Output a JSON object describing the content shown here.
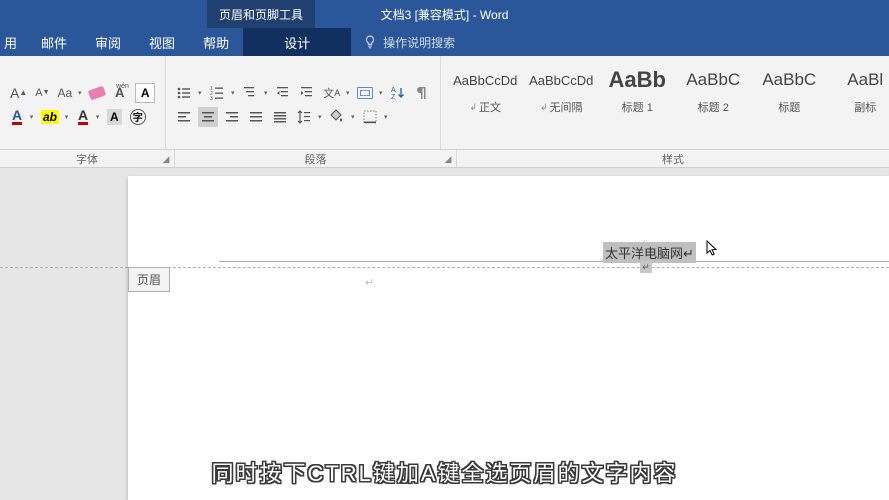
{
  "title": {
    "context_tab": "页眉和页脚工具",
    "document": "文档3 [兼容模式]  -  Word"
  },
  "menu": {
    "items": [
      "用",
      "邮件",
      "审阅",
      "视图",
      "帮助",
      "设计"
    ],
    "active_index": 5,
    "tell_me": "操作说明搜索"
  },
  "font_group": {
    "label": "字体"
  },
  "para_group": {
    "label": "段落"
  },
  "styles_group": {
    "label": "样式",
    "items": [
      {
        "sample": "AaBbCcDd",
        "name": "正文",
        "pinned": true,
        "size": 13
      },
      {
        "sample": "AaBbCcDd",
        "name": "无间隔",
        "pinned": true,
        "size": 13
      },
      {
        "sample": "AaBb",
        "name": "标题 1",
        "pinned": false,
        "size": 22,
        "bold": true
      },
      {
        "sample": "AaBbC",
        "name": "标题 2",
        "pinned": false,
        "size": 17
      },
      {
        "sample": "AaBbC",
        "name": "标题",
        "pinned": false,
        "size": 17
      },
      {
        "sample": "AaBl",
        "name": "副标",
        "pinned": false,
        "size": 17
      }
    ]
  },
  "document_area": {
    "header_tag": "页眉",
    "selected_text": "太平洋电脑网↵"
  },
  "caption": "同时按下CTRL键加A键全选页眉的文字内容"
}
